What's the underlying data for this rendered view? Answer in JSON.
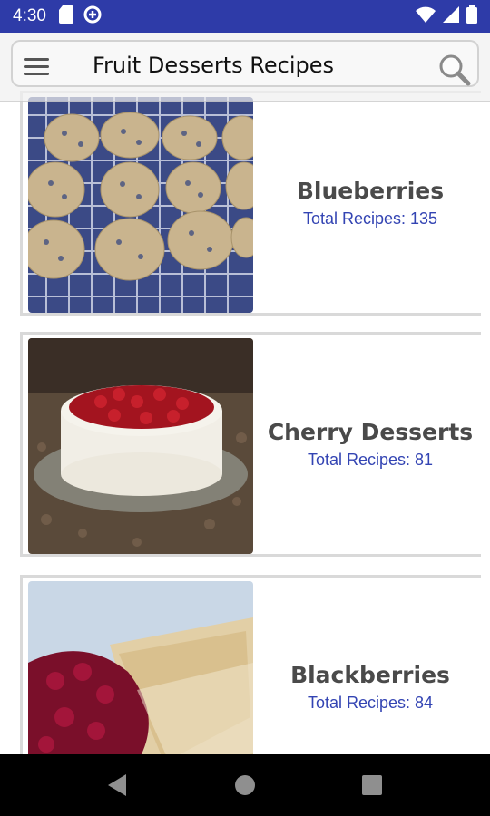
{
  "status_bar": {
    "time": "4:30",
    "icons_left": [
      "sd-card-icon",
      "data-saver-icon"
    ],
    "icons_right": [
      "wifi-icon",
      "signal-icon",
      "battery-icon"
    ],
    "background_color": "#2e3ba8"
  },
  "toolbar": {
    "title": "Fruit Desserts Recipes",
    "menu_icon": "hamburger-menu-icon",
    "search_icon": "search-icon"
  },
  "recipes": [
    {
      "title": "Blueberries",
      "count": "Total Recipes: 135",
      "image": "blueberry-cookies-photo"
    },
    {
      "title": "Cherry Desserts",
      "count": "Total Recipes: 81",
      "image": "cherry-cake-photo"
    },
    {
      "title": "Blackberries",
      "count": "Total Recipes: 84",
      "image": "blackberry-pie-photo"
    }
  ],
  "colors": {
    "accent": "#3344b3",
    "title_text": "#4a4a4a"
  },
  "nav_bar": {
    "buttons": [
      "back-icon",
      "home-icon",
      "recents-icon"
    ]
  }
}
